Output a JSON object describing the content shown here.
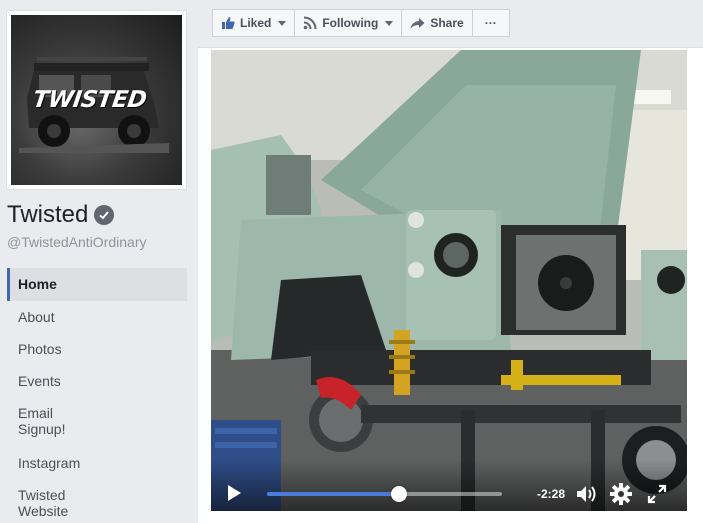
{
  "page": {
    "name": "Twisted",
    "handle": "@TwistedAntiOrdinary",
    "logo_text": "TWISTED"
  },
  "nav": {
    "items": [
      {
        "label": "Home",
        "active": true
      },
      {
        "label": "About"
      },
      {
        "label": "Photos"
      },
      {
        "label": "Events"
      },
      {
        "label": "Email Signup!"
      },
      {
        "label": "Instagram"
      },
      {
        "label": "Twisted Website"
      }
    ]
  },
  "actions": {
    "liked": {
      "label": "Liked",
      "icon": "thumbs-up-icon"
    },
    "following": {
      "label": "Following",
      "icon": "rss-icon"
    },
    "share": {
      "label": "Share",
      "icon": "share-arrow-icon"
    },
    "more": {
      "label": "···",
      "icon": "more-dots-icon"
    }
  },
  "video": {
    "remaining_time": "-2:28",
    "progress": 0.56
  },
  "colors": {
    "accent": "#4267b2",
    "progress": "#4b7bd8",
    "page_bg": "#e9ebee"
  }
}
